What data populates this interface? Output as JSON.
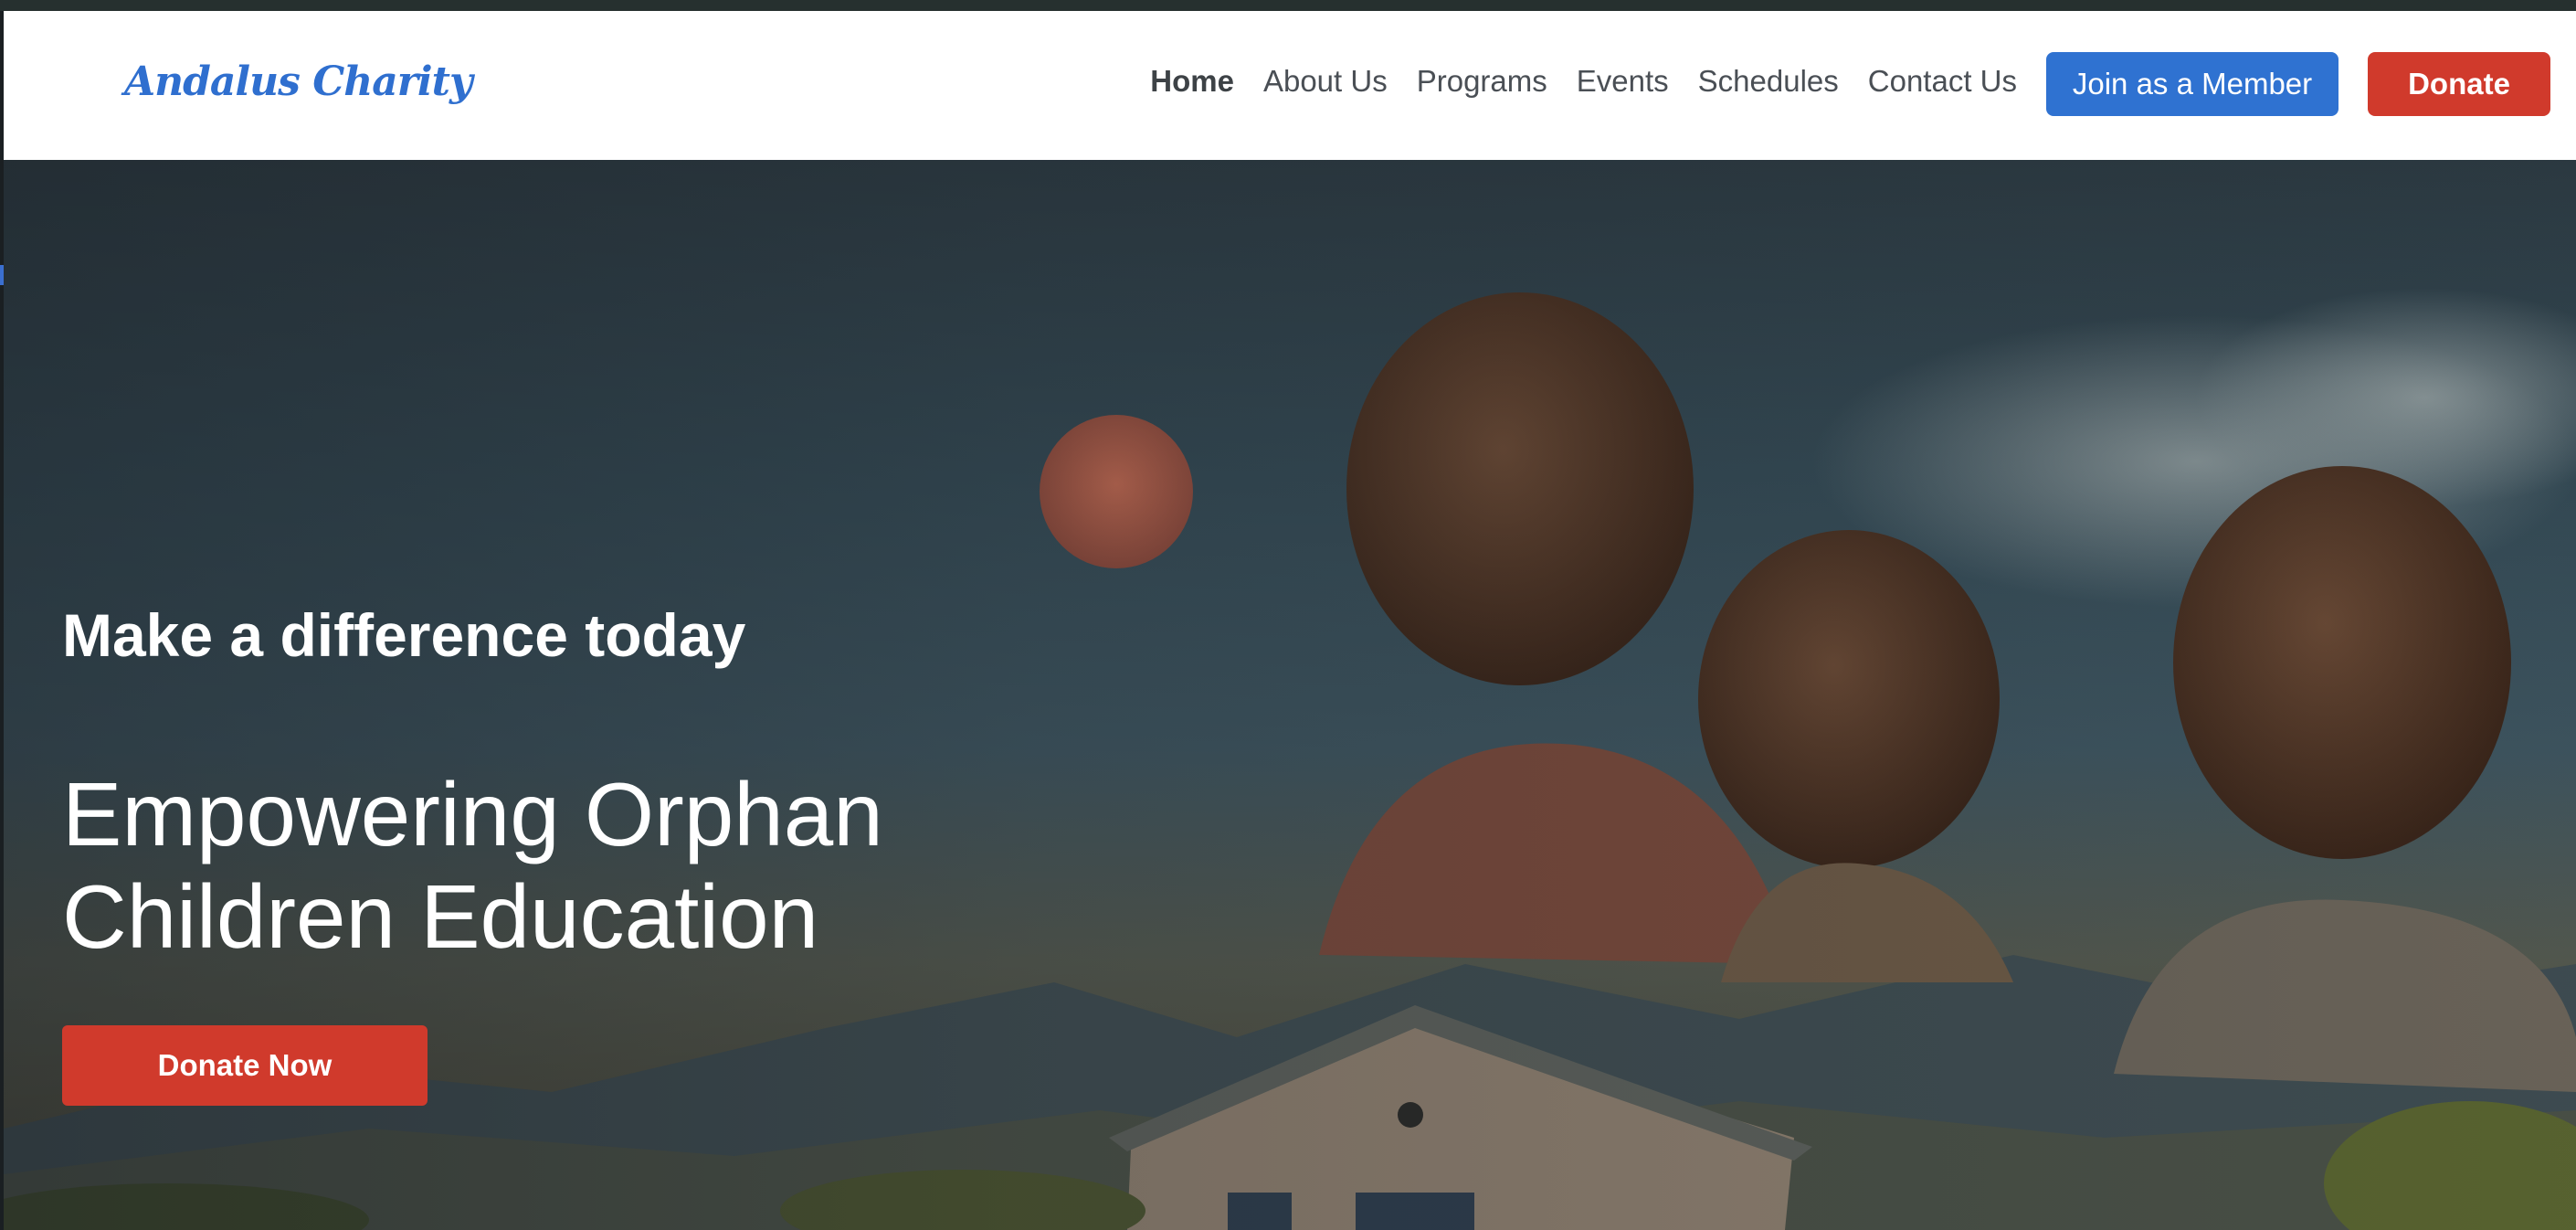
{
  "brand": {
    "logo_text": "Andalus Charity"
  },
  "nav": {
    "links": [
      {
        "label": "Home"
      },
      {
        "label": "About Us"
      },
      {
        "label": "Programs"
      },
      {
        "label": "Events"
      },
      {
        "label": "Schedules"
      },
      {
        "label": "Contact Us"
      }
    ],
    "active": "Home",
    "join_label": "Join as a Member",
    "donate_label": "Donate"
  },
  "hero": {
    "tagline": "Make a difference today",
    "headline_line1": "Empowering Orphan",
    "headline_line2": "Children Education",
    "cta_label": "Donate Now",
    "image_icon": "children-landscape-illustration"
  },
  "colors": {
    "accent_blue": "#2f72d1",
    "accent_red": "#d03a2c",
    "logo_blue": "#2f6fcf",
    "nav_text": "#4a4f55"
  }
}
